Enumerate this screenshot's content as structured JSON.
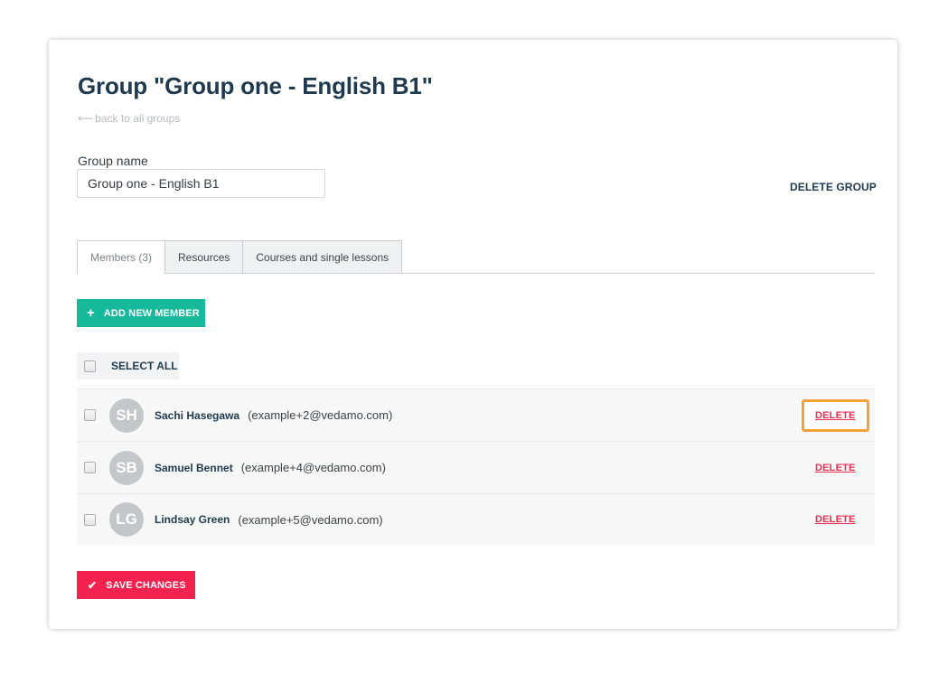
{
  "header": {
    "title": "Group \"Group one - English B1\"",
    "back_link": "back to all groups",
    "back_arrow": "⟵"
  },
  "form": {
    "group_name_label": "Group name",
    "group_name_value": "Group one - English B1",
    "delete_group_label": "DELETE GROUP"
  },
  "tabs": [
    {
      "label": "Members (3)",
      "active": true
    },
    {
      "label": "Resources",
      "active": false
    },
    {
      "label": "Courses and single lessons",
      "active": false
    }
  ],
  "actions": {
    "add_member_label": "ADD NEW MEMBER",
    "add_member_icon": "plus-icon",
    "select_all_label": "SELECT ALL",
    "save_label": "SAVE CHANGES",
    "save_icon": "check-icon"
  },
  "members": [
    {
      "initials": "SH",
      "name": "Sachi Hasegawa",
      "email": "(example+2@vedamo.com)",
      "delete_label": "DELETE",
      "highlighted": true
    },
    {
      "initials": "SB",
      "name": "Samuel Bennet",
      "email": "(example+4@vedamo.com)",
      "delete_label": "DELETE",
      "highlighted": false
    },
    {
      "initials": "LG",
      "name": "Lindsay Green",
      "email": "(example+5@vedamo.com)",
      "delete_label": "DELETE",
      "highlighted": false
    }
  ],
  "colors": {
    "title": "#1f3a4f",
    "add_button": "#16b99b",
    "save_button": "#f3224e",
    "delete_link": "#e8314f",
    "highlight_border": "#f5a03a",
    "avatar": "#c2c7cb"
  }
}
